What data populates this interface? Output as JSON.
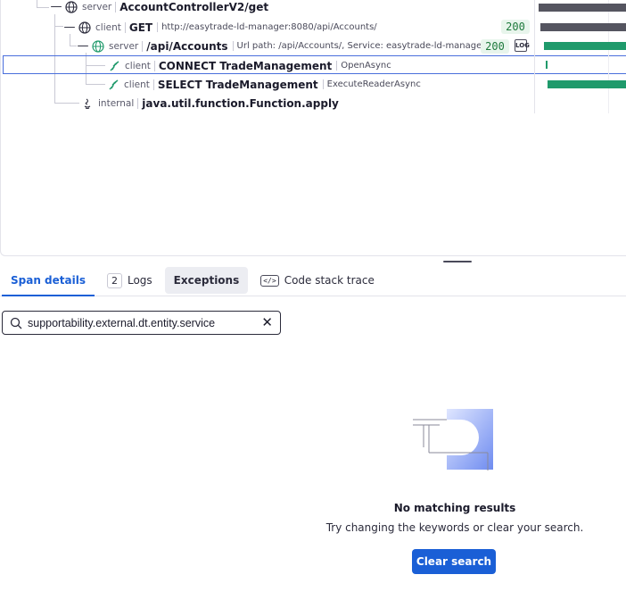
{
  "trace": {
    "rows": [
      {
        "toggle": "—",
        "kind": "server",
        "name": "AccountControllerV2/get",
        "meta": ""
      },
      {
        "toggle": "—",
        "kind": "client",
        "name": "GET",
        "meta": "http://easytrade-ld-manager:8080/api/Accounts/",
        "status": "200"
      },
      {
        "toggle": "—",
        "kind": "server",
        "name": "/api/Accounts",
        "meta": "Url path: /api/Accounts/, Service: easytrade-ld-manage...",
        "status": "200",
        "log_label": "LOG"
      },
      {
        "kind": "client",
        "name": "CONNECT TradeManagement",
        "meta": "OpenAsync"
      },
      {
        "kind": "client",
        "name": "SELECT TradeManagement",
        "meta": "ExecuteReaderAsync"
      },
      {
        "kind": "internal",
        "name": "java.util.function.Function.apply",
        "meta": ""
      }
    ],
    "colors": {
      "bar_gray": "#555560",
      "bar_green": "#1f9a6b",
      "selected_border": "#4a6fdc"
    }
  },
  "tabs": [
    {
      "label": "Span details"
    },
    {
      "count": "2",
      "label": "Logs"
    },
    {
      "label": "Exceptions"
    },
    {
      "glyph": "</>",
      "label": "Code stack trace"
    }
  ],
  "search": {
    "value": "supportability.external.dt.entity.service",
    "clear_glyph": "✕"
  },
  "empty_state": {
    "title": "No matching results",
    "subtitle": "Try changing the keywords or clear your search.",
    "button_label": "Clear search"
  },
  "accent": "#1a5fd6"
}
